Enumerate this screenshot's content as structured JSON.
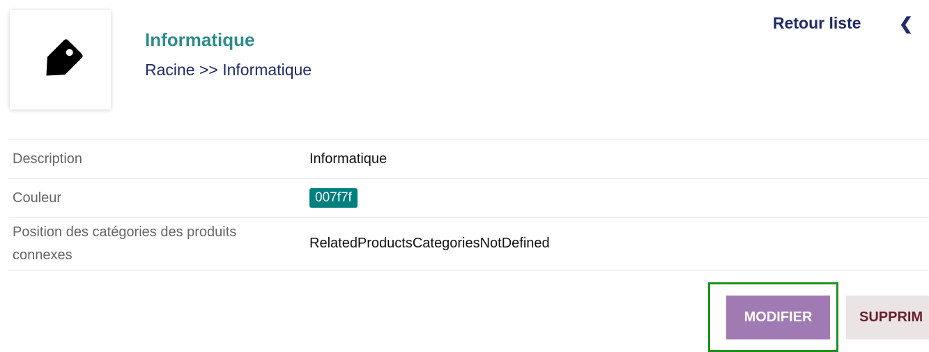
{
  "header": {
    "title": "Informatique",
    "breadcrumb": "Racine >> Informatique",
    "back_link": "Retour liste",
    "chevron_icon": "chevron-left-icon",
    "logo_icon": "tag-icon"
  },
  "properties": [
    {
      "label": "Description",
      "value": "Informatique"
    },
    {
      "label": "Couleur",
      "value": "007f7f"
    },
    {
      "label": "Position des catégories des produits connexes",
      "value": "RelatedProductsCategoriesNotDefined"
    }
  ],
  "actions": {
    "modify": "MODIFIER",
    "delete": "SUPPRIM"
  },
  "colors": {
    "title": "#2e8b8b",
    "nav": "#1f2b6b",
    "badge": "#007f7f",
    "modify_button": "#a07bb3",
    "highlight_box": "#1f8f1f"
  }
}
